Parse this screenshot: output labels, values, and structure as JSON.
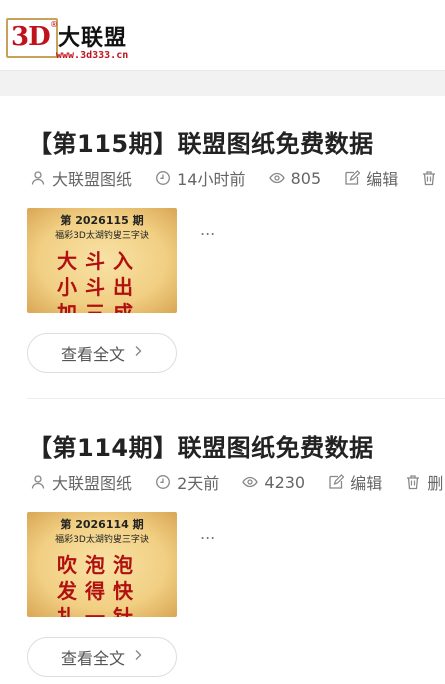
{
  "site": {
    "logo_mark": "3D",
    "logo_reg": "®",
    "logo_name": "大联盟",
    "logo_url": "www.3d333.cn"
  },
  "posts": [
    {
      "title": "【第115期】联盟图纸免费数据",
      "author": "大联盟图纸",
      "time": "14小时前",
      "views": "805",
      "edit_label": "编辑",
      "thumb_issue": "第 2026115 期",
      "thumb_sub": "福彩3D太湖钓叟三字诀",
      "thumb_lines": [
        "大斗入",
        "小斗出",
        "加三成"
      ],
      "excerpt": "...",
      "readmore": "查看全文"
    },
    {
      "title": "【第114期】联盟图纸免费数据",
      "author": "大联盟图纸",
      "time": "2天前",
      "views": "4230",
      "edit_label": "编辑",
      "delete_label": "删",
      "thumb_issue": "第 2026114 期",
      "thumb_sub": "福彩3D太湖钓叟三字诀",
      "thumb_lines": [
        "吹泡泡",
        "发得快",
        "扎一针"
      ],
      "excerpt": "...",
      "readmore": "查看全文"
    }
  ],
  "icons": {
    "author": "user-icon",
    "time": "clock-icon",
    "views": "eye-icon",
    "edit": "edit-icon",
    "delete": "trash-icon",
    "readmore": "chevron-right-icon"
  },
  "colors": {
    "brand_red": "#c0121b",
    "thumb_bg": "#f1cf83"
  }
}
